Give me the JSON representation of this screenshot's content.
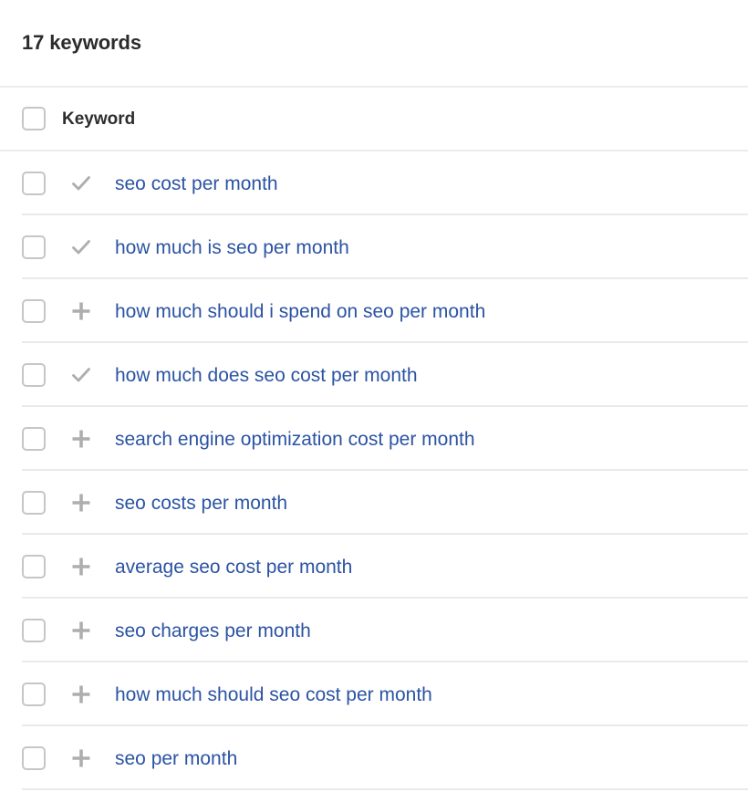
{
  "header": {
    "title": "17 keywords"
  },
  "table": {
    "columns": [
      {
        "key": "keyword",
        "label": "Keyword"
      }
    ],
    "select_all_checkbox": {
      "name": "select-all-checkbox",
      "checked": false
    },
    "rows": [
      {
        "checked": false,
        "status": "check-icon",
        "keyword": "seo cost per month"
      },
      {
        "checked": false,
        "status": "check-icon",
        "keyword": "how much is seo per month"
      },
      {
        "checked": false,
        "status": "plus-icon",
        "keyword": "how much should i spend on seo per month"
      },
      {
        "checked": false,
        "status": "check-icon",
        "keyword": "how much does seo cost per month"
      },
      {
        "checked": false,
        "status": "plus-icon",
        "keyword": "search engine optimization cost per month"
      },
      {
        "checked": false,
        "status": "plus-icon",
        "keyword": "seo costs per month"
      },
      {
        "checked": false,
        "status": "plus-icon",
        "keyword": "average seo cost per month"
      },
      {
        "checked": false,
        "status": "plus-icon",
        "keyword": "seo charges per month"
      },
      {
        "checked": false,
        "status": "plus-icon",
        "keyword": "how much should seo cost per month"
      },
      {
        "checked": false,
        "status": "plus-icon",
        "keyword": "seo per month"
      }
    ]
  },
  "colors": {
    "link": "#2b53a3",
    "title_text": "#2b2b2b",
    "header_text": "#2d2d2d",
    "icon_gray": "#aeaeae",
    "checkbox_border": "#c6c6c8",
    "divider": "#e9e9ee",
    "header_divider": "#ececf0",
    "background": "#ffffff"
  }
}
